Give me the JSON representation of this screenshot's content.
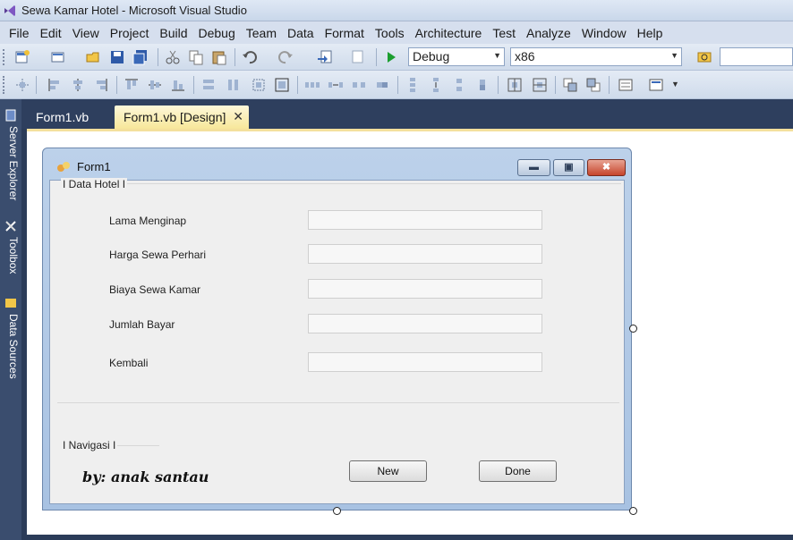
{
  "window": {
    "title": "Sewa Kamar Hotel - Microsoft Visual Studio"
  },
  "menu": [
    "File",
    "Edit",
    "View",
    "Project",
    "Build",
    "Debug",
    "Team",
    "Data",
    "Format",
    "Tools",
    "Architecture",
    "Test",
    "Analyze",
    "Window",
    "Help"
  ],
  "toolbar": {
    "config_value": "Debug",
    "platform_value": "x86",
    "search_value": ""
  },
  "side_tabs": [
    "Server Explorer",
    "Toolbox",
    "Data Sources"
  ],
  "doc_tabs": {
    "inactive": "Form1.vb",
    "active": "Form1.vb [Design]",
    "close_glyph": "✕"
  },
  "form": {
    "title": "Form1",
    "min_glyph": "▬",
    "max_glyph": "▣",
    "close_glyph": "✖",
    "group_data": "I Data Hotel I",
    "group_nav": "I Navigasi I",
    "fields": [
      {
        "label": "Lama Menginap",
        "value": ""
      },
      {
        "label": "Harga Sewa Perhari",
        "value": ""
      },
      {
        "label": "Biaya Sewa Kamar",
        "value": ""
      },
      {
        "label": "Jumlah Bayar",
        "value": ""
      },
      {
        "label": "Kembali",
        "value": ""
      }
    ],
    "btn_new": "New",
    "btn_done": "Done",
    "signature": "by: anak santau"
  }
}
